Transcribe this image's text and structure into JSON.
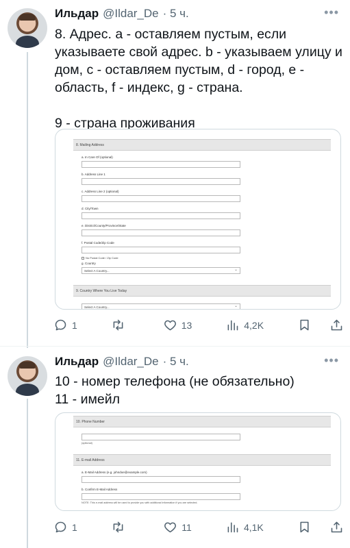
{
  "tweets": [
    {
      "author_name": "Ильдар",
      "handle": "@Ildar_De",
      "time": "· 5 ч.",
      "text": "8. Адрес. a - оставляем пустым, если указываете свой адрес. b - указываем улицу и дом, c - оставляем пустым, d - город, e - область, f - индекс, g - страна.\n\n9 - страна проживания",
      "media": {
        "section1_title": "8. Mailing Address",
        "fields": [
          "a. In Care Of (optional)",
          "b. Address Line 1",
          "c. Address Line 2 (optional)",
          "d. City/Town",
          "e. District/County/Province/State",
          "f. Postal Code/Zip Code"
        ],
        "no_postal_code": "No Postal Code / Zip Code",
        "country_label": "g. Country",
        "country_select": "Select A Country...",
        "section2_title": "9. Country Where You Live Today",
        "country_select2": "Select A Country..."
      },
      "replies": "1",
      "reposts": "",
      "likes": "13",
      "views": "4,2K"
    },
    {
      "author_name": "Ильдар",
      "handle": "@Ildar_De",
      "time": "· 5 ч.",
      "text": "10 - номер телефона (не обязательно)\n11 - имейл",
      "media": {
        "section1_title": "10. Phone Number",
        "phone_hint": "(optional)",
        "section2_title": "11. E-mail Address",
        "email_label": "a. E-Mail Address (e.g. johndoe@example.com)",
        "confirm_label": "b. Confirm E-Mail Address",
        "note": "NOTE: This e-mail address will be used to provide you with additional information if you are selected."
      },
      "replies": "1",
      "reposts": "",
      "likes": "11",
      "views": "4,1K"
    }
  ],
  "more_symbol": "•••"
}
